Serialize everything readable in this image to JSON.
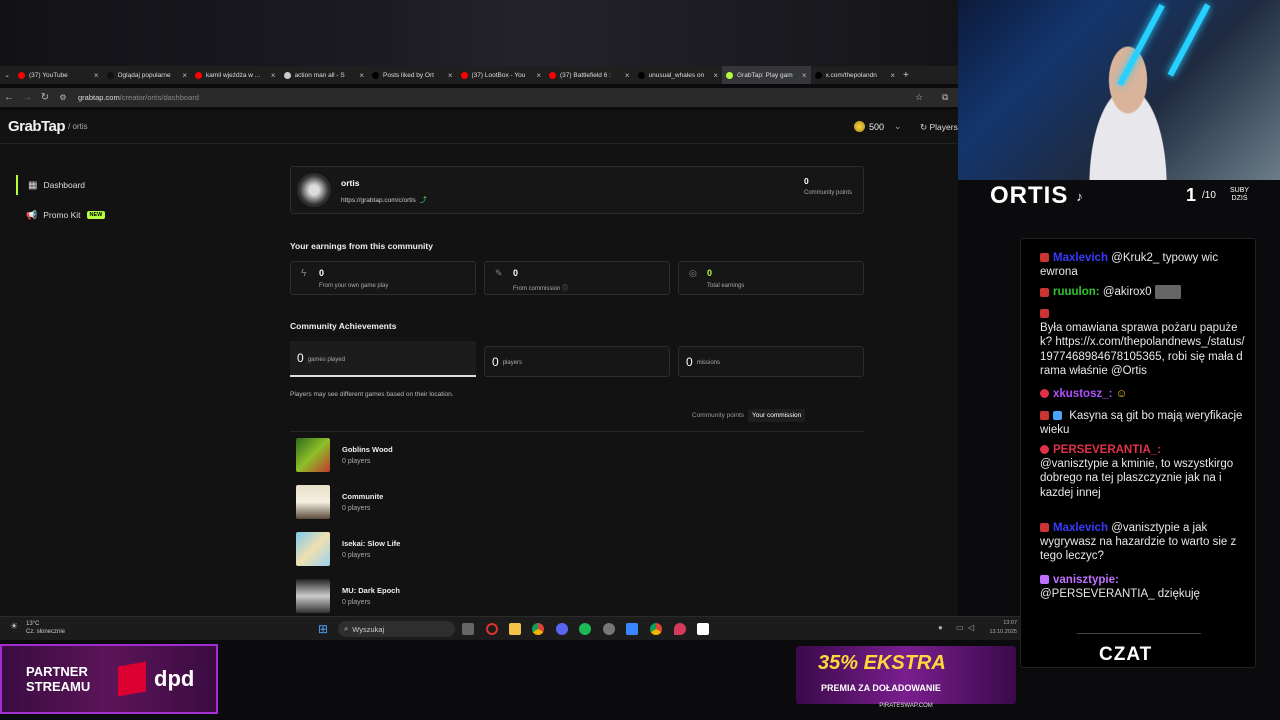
{
  "browser": {
    "tabs": [
      {
        "label": "(37) YouTube",
        "color": "#ff0000"
      },
      {
        "label": "Oglądaj popularne",
        "color": "#111111"
      },
      {
        "label": "kamil wjeżdża w ...",
        "color": "#ff0000"
      },
      {
        "label": "action man all - S",
        "color": "#cccccc"
      },
      {
        "label": "Posts liked by Ort",
        "color": "#000000"
      },
      {
        "label": "(37) LootBox - You",
        "color": "#ff0000"
      },
      {
        "label": "(37) Battlefield 6 :",
        "color": "#ff0000"
      },
      {
        "label": "unusual_whales on",
        "color": "#000000"
      },
      {
        "label": "GrabTap: Play gam",
        "color": "#b7ff3c",
        "active": true
      },
      {
        "label": "x.com/thepolandn",
        "color": "#000000"
      }
    ],
    "new_tab": "+",
    "url_host": "grabtap.com",
    "url_path": "/creator/ortis/dashboard"
  },
  "site": {
    "logo": "GrabTap",
    "breadcrumb": "/ ortis",
    "coins": "500",
    "players_btn": "Players",
    "sidebar": [
      {
        "label": "Dashboard",
        "active": true
      },
      {
        "label": "Promo Kit",
        "badge": "NEW"
      }
    ],
    "profile": {
      "name": "ortis",
      "link": "https://grabtap.com/c/ortis",
      "points_value": "0",
      "points_label": "Community points"
    },
    "earnings_title": "Your earnings from this community",
    "earnings": [
      {
        "value": "0",
        "label": "From your own game play"
      },
      {
        "value": "0",
        "label": "From commission"
      },
      {
        "value": "0",
        "label": "Total earnings"
      }
    ],
    "achievements_title": "Community Achievements",
    "achievements": [
      {
        "value": "0",
        "label": "games played"
      },
      {
        "value": "0",
        "label": "players"
      },
      {
        "value": "0",
        "label": "missions"
      }
    ],
    "location_note": "Players may see different games based on their location.",
    "toggle": {
      "left": "Community points",
      "right": "Your commission"
    },
    "games": [
      {
        "name": "Goblins Wood",
        "players": "0 players"
      },
      {
        "name": "Communite",
        "players": "0 players"
      },
      {
        "name": "Isekai: Slow Life",
        "players": "0 players"
      },
      {
        "name": "MU: Dark Epoch",
        "players": "0 players"
      }
    ]
  },
  "taskbar": {
    "temp": "13°C",
    "weather": "Cz. słonecznie",
    "search": "Wyszukaj",
    "time": "13:07",
    "date": "13.10.2025"
  },
  "stream": {
    "name": "ORTIS",
    "subs_current": "1",
    "subs_total": "/10",
    "subs_label_1": "SUBY",
    "subs_label_2": "DZIŚ",
    "chat_title": "CZAT",
    "chat": [
      {
        "user": "Maxlevich",
        "color": "#3a3aff",
        "text": "@Kruk2_ typowy wic ewrona"
      },
      {
        "user": "ruuulon:",
        "color": "#35c235",
        "text": "@akirox0"
      },
      {
        "user": "",
        "color": "#ffffff",
        "text": "Była omawiana sprawa pożaru papużek? https://x.com/thepolandnews_/status/1977468984678105365, robi się mała drama właśnie @Ortis"
      },
      {
        "user": "xkustosz_:",
        "color": "#b04fff",
        "text": ""
      },
      {
        "user": "",
        "color": "#ffffff",
        "text": "Kasyna są git bo mają weryfikacje wieku"
      },
      {
        "user": "PERSEVERANTIA_:",
        "color": "#e0304a",
        "text": "@vanisztypie a kminie, to wszystkirgo dobrego na tej plaszczyznie jak na i kazdej innej"
      },
      {
        "user": "Maxlevich",
        "color": "#3a3aff",
        "text": "@vanisztypie a jak wygrywasz na hazardzie to warto sie z tego leczyc?"
      },
      {
        "user": "vanisztypie:",
        "color": "#c070ff",
        "text": "@PERSEVERANTIA_ dziękuję"
      }
    ],
    "partner_line1": "PARTNER",
    "partner_line2": "STREAMU",
    "partner_brand": "dpd",
    "promo_big": "35% EKSTRA",
    "promo_small": "PREMIA ZA DOŁADOWANIE",
    "promo_url": "PIRATESWAP.COM"
  }
}
